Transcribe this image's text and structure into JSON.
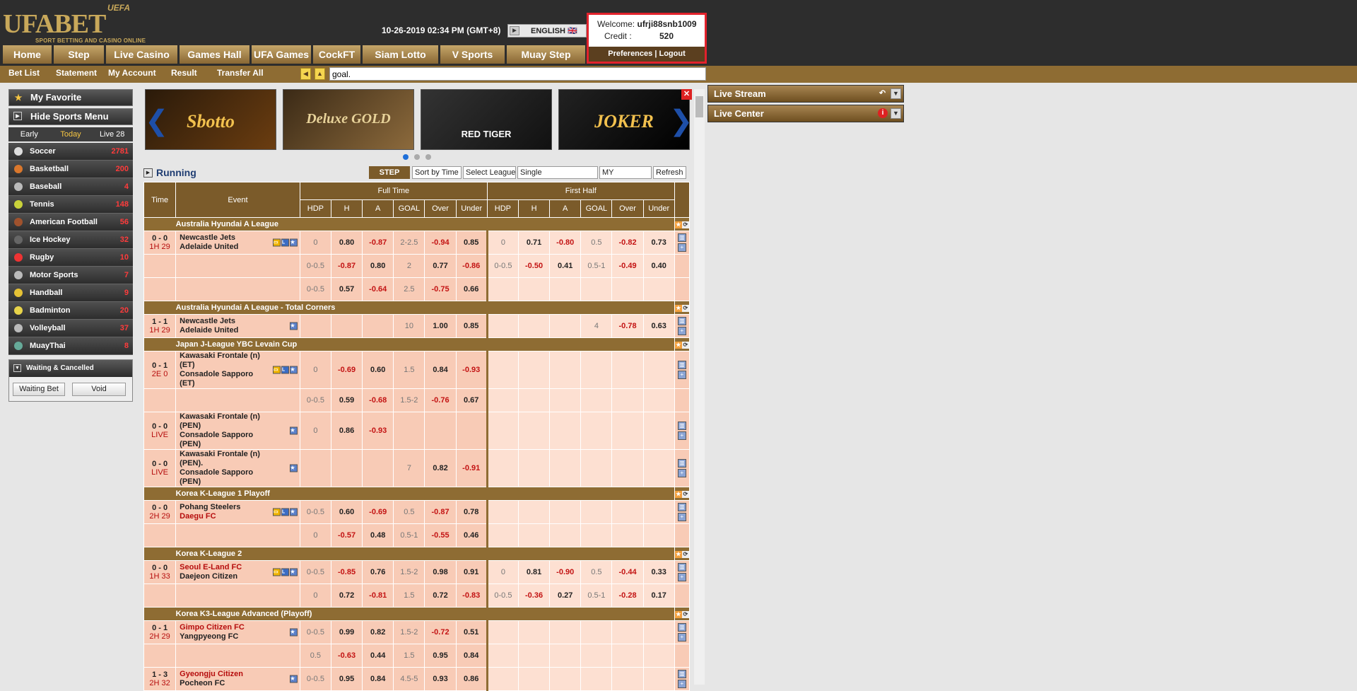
{
  "header": {
    "logo_text": "UFABET",
    "logo_uefa": "UEFA",
    "logo_tag": "SPORT BETTING AND CASINO ONLINE",
    "datetime": "10-26-2019 02:34 PM (GMT+8)",
    "language": "ENGLISH 🇬🇧"
  },
  "account": {
    "welcome_label": "Welcome:",
    "username": "ufrji88snb1009",
    "credit_label": "Credit   :",
    "credit": "520",
    "preferences": "Preferences",
    "sep": "|",
    "logout": "Logout"
  },
  "nav": [
    "Home",
    "Step",
    "Live Casino",
    "Games Hall",
    "UFA Games",
    "CockFT",
    "Siam Lotto",
    "V Sports",
    "Muay Step"
  ],
  "subnav": [
    "Bet List",
    "Statement",
    "My Account",
    "Result",
    "Transfer All"
  ],
  "search": {
    "value": "goal."
  },
  "left": {
    "favorite": "My Favorite",
    "hide_menu": "Hide Sports Menu",
    "tabs": [
      "Early",
      "Today",
      "Live 28"
    ],
    "sports": [
      [
        "Soccer",
        "2781"
      ],
      [
        "Basketball",
        "200"
      ],
      [
        "Baseball",
        "4"
      ],
      [
        "Tennis",
        "148"
      ],
      [
        "American Football",
        "56"
      ],
      [
        "Ice Hockey",
        "32"
      ],
      [
        "Rugby",
        "10"
      ],
      [
        "Motor Sports",
        "7"
      ],
      [
        "Handball",
        "9"
      ],
      [
        "Badminton",
        "20"
      ],
      [
        "Volleyball",
        "37"
      ],
      [
        "MuayThai",
        "8"
      ]
    ],
    "waiting": "Waiting & Cancelled",
    "waiting_bet": "Waiting Bet",
    "void": "Void"
  },
  "banners": [
    "Sbotto",
    "Deluxe GOLD",
    "RED TIGER",
    "JOKER"
  ],
  "running": {
    "title": "Running",
    "step": "STEP",
    "sort": "Sort by Time",
    "league": "Select League",
    "single": "Single",
    "my": "MY",
    "refresh": "Refresh"
  },
  "table": {
    "time": "Time",
    "event": "Event",
    "full_time": "Full Time",
    "first_half": "First Half",
    "cols": [
      "HDP",
      "H",
      "A",
      "GOAL",
      "Over",
      "Under",
      "HDP",
      "H",
      "A",
      "GOAL",
      "Over",
      "Under"
    ]
  },
  "leagues": [
    {
      "name": "Australia Hyundai A League",
      "rows": [
        {
          "score": "0 - 0",
          "time": "1H 29",
          "home": "Newcastle Jets",
          "away": "Adelaide United",
          "badges": true,
          "v": [
            "0",
            "0.80",
            "-0.87",
            "2-2.5",
            "-0.94",
            "0.85",
            "0",
            "0.71",
            "-0.80",
            "0.5",
            "-0.82",
            "0.73"
          ]
        },
        {
          "v": [
            "0-0.5",
            "-0.87",
            "0.80",
            "2",
            "0.77",
            "-0.86",
            "0-0.5",
            "-0.50",
            "0.41",
            "0.5-1",
            "-0.49",
            "0.40"
          ]
        },
        {
          "v": [
            "0-0.5",
            "0.57",
            "-0.64",
            "2.5",
            "-0.75",
            "0.66",
            "",
            "",
            "",
            "",
            "",
            ""
          ]
        }
      ]
    },
    {
      "name": "Australia Hyundai A League - Total Corners",
      "rows": [
        {
          "score": "1 - 1",
          "time": "1H 29",
          "home": "Newcastle Jets",
          "away": "Adelaide United",
          "v": [
            "",
            "",
            "",
            "10",
            "1.00",
            "0.85",
            "",
            "",
            "",
            "4",
            "-0.78",
            "0.63"
          ]
        }
      ]
    },
    {
      "name": "Japan J-League YBC Levain Cup",
      "rows": [
        {
          "score": "0 - 1",
          "time": "2E 0",
          "home": "Kawasaki Frontale (n) (ET)",
          "away": "Consadole Sapporo (ET)",
          "badges": true,
          "v": [
            "0",
            "-0.69",
            "0.60",
            "1.5",
            "0.84",
            "-0.93",
            "",
            "",
            "",
            "",
            "",
            ""
          ],
          "tall": true
        },
        {
          "v": [
            "0-0.5",
            "0.59",
            "-0.68",
            "1.5-2",
            "-0.76",
            "0.67",
            "",
            "",
            "",
            "",
            "",
            ""
          ]
        },
        {
          "score": "0 - 0",
          "time": "LIVE",
          "home": "Kawasaki Frontale (n) (PEN)",
          "away": "Consadole Sapporo (PEN)",
          "v": [
            "0",
            "0.86",
            "-0.93",
            "",
            "",
            "",
            "",
            "",
            "",
            "",
            "",
            ""
          ],
          "tall": true
        },
        {
          "score": "0 - 0",
          "time": "LIVE",
          "home": "Kawasaki Frontale (n) (PEN).",
          "away": "Consadole Sapporo (PEN)",
          "v": [
            "",
            "",
            "",
            "7",
            "0.82",
            "-0.91",
            "",
            "",
            "",
            "",
            "",
            ""
          ],
          "tall": true
        }
      ]
    },
    {
      "name": "Korea K-League 1 Playoff",
      "rows": [
        {
          "score": "0 - 0",
          "time": "2H 29",
          "home": "Pohang Steelers",
          "away": "Daegu FC",
          "awayRed": true,
          "badges": true,
          "v": [
            "0-0.5",
            "0.60",
            "-0.69",
            "0.5",
            "-0.87",
            "0.78",
            "",
            "",
            "",
            "",
            "",
            ""
          ]
        },
        {
          "v": [
            "0",
            "-0.57",
            "0.48",
            "0.5-1",
            "-0.55",
            "0.46",
            "",
            "",
            "",
            "",
            "",
            ""
          ]
        }
      ]
    },
    {
      "name": "Korea K-League 2",
      "rows": [
        {
          "score": "0 - 0",
          "time": "1H 33",
          "home": "Seoul E-Land FC",
          "homeRed": true,
          "away": "Daejeon Citizen",
          "badges": true,
          "v": [
            "0-0.5",
            "-0.85",
            "0.76",
            "1.5-2",
            "0.98",
            "0.91",
            "0",
            "0.81",
            "-0.90",
            "0.5",
            "-0.44",
            "0.33"
          ]
        },
        {
          "v": [
            "0",
            "0.72",
            "-0.81",
            "1.5",
            "0.72",
            "-0.83",
            "0-0.5",
            "-0.36",
            "0.27",
            "0.5-1",
            "-0.28",
            "0.17"
          ]
        }
      ]
    },
    {
      "name": "Korea K3-League Advanced (Playoff)",
      "rows": [
        {
          "score": "0 - 1",
          "time": "2H 29",
          "home": "Gimpo Citizen FC",
          "homeRed": true,
          "away": "Yangpyeong FC",
          "v": [
            "0-0.5",
            "0.99",
            "0.82",
            "1.5-2",
            "-0.72",
            "0.51",
            "",
            "",
            "",
            "",
            "",
            ""
          ]
        },
        {
          "v": [
            "0.5",
            "-0.63",
            "0.44",
            "1.5",
            "0.95",
            "0.84",
            "",
            "",
            "",
            "",
            "",
            ""
          ]
        },
        {
          "score": "1 - 3",
          "time": "2H 32",
          "home": "Gyeongju Citizen",
          "homeRed": true,
          "away": "Pocheon FC",
          "v": [
            "0-0.5",
            "0.95",
            "0.84",
            "4.5-5",
            "0.93",
            "0.86",
            "",
            "",
            "",
            "",
            "",
            ""
          ]
        }
      ]
    }
  ],
  "right": {
    "live_stream": "Live Stream",
    "live_center": "Live Center"
  }
}
